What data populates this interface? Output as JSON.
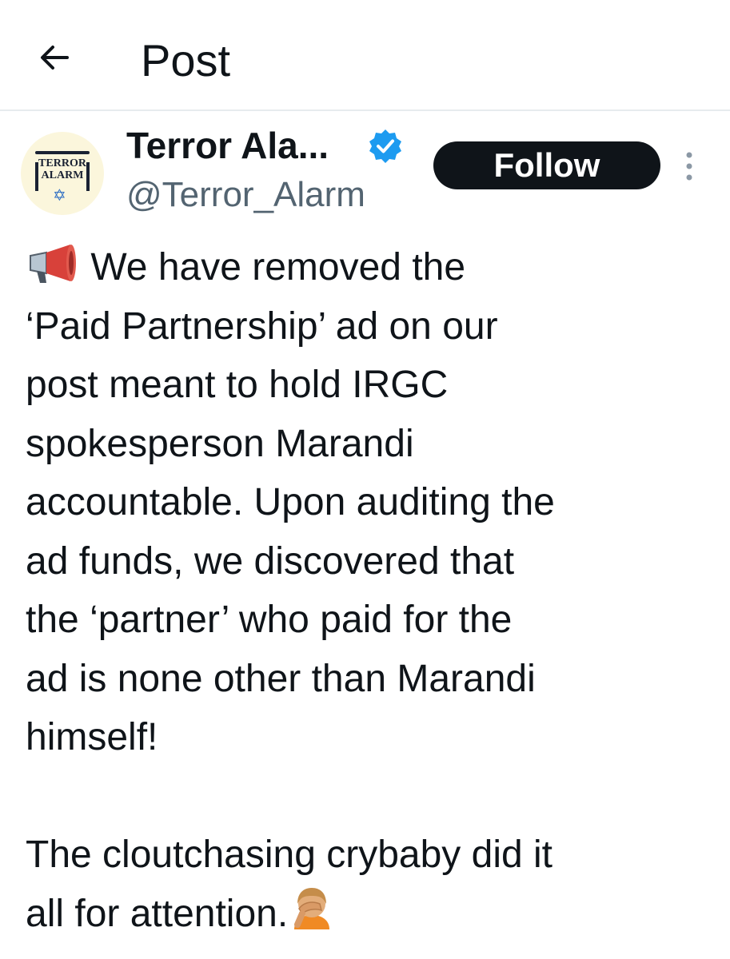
{
  "header": {
    "back_icon": "arrow-left-icon",
    "title": "Post"
  },
  "author": {
    "avatar_text_line1": "TERROR",
    "avatar_text_line2": "ALARM",
    "display_name": "Terror Ala...",
    "verified_icon": "verified-badge-icon",
    "verified_color": "#1d9bf0",
    "handle": "@Terror_Alarm"
  },
  "actions": {
    "follow_label": "Follow",
    "more_icon": "more-vertical-icon"
  },
  "post": {
    "lead_icon": "megaphone-icon",
    "lines": [
      "We have removed the",
      "‘Paid Partnership’ ad on our",
      "post meant to hold IRGC",
      "spokesperson Marandi",
      "accountable. Upon auditing the",
      "ad funds, we discovered that",
      "the ‘partner’ who paid for the",
      "ad is none other than Marandi",
      "himself!",
      "",
      "The cloutchasing crybaby did it",
      "all for attention."
    ],
    "trailing_icon": "facepalm-emoji-icon"
  },
  "colors": {
    "text": "#0f1419",
    "secondary_text": "#536471",
    "divider": "#e7ebee",
    "follow_bg": "#0f1419"
  }
}
